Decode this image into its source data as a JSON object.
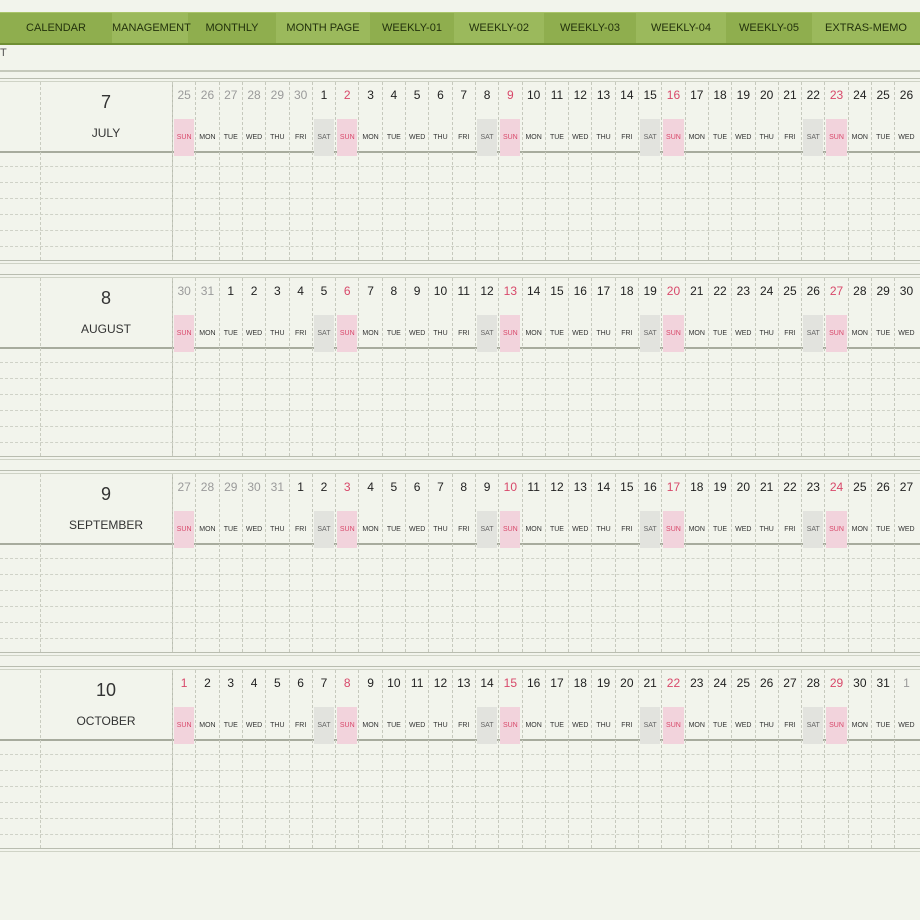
{
  "nav": {
    "tabs": [
      {
        "label": "CALENDAR"
      },
      {
        "label": "MANAGEMENT"
      },
      {
        "label": "MONTHLY"
      },
      {
        "label": "MONTH PAGE"
      },
      {
        "label": "WEEKLY-01"
      },
      {
        "label": "WEEKLY-02"
      },
      {
        "label": "WEEKLY-03"
      },
      {
        "label": "WEEKLY-04"
      },
      {
        "label": "WEEKLY-05"
      },
      {
        "label": "EXTRAS-MEMO"
      }
    ]
  },
  "subheader": {
    "fragment": "T"
  },
  "colors": {
    "nav": "#8fae4e",
    "sunday": "#d8486a",
    "sunday_bg": "#f2d3dc",
    "saturday_bg": "#e2e3de",
    "background": "#f2f4ec"
  },
  "months": [
    {
      "number": "7",
      "name": "JULY",
      "start_weekday": 0,
      "days": [
        {
          "n": "25",
          "other": true
        },
        {
          "n": "26",
          "other": true
        },
        {
          "n": "27",
          "other": true
        },
        {
          "n": "28",
          "other": true
        },
        {
          "n": "29",
          "other": true
        },
        {
          "n": "30",
          "other": true
        },
        {
          "n": "1"
        },
        {
          "n": "2"
        },
        {
          "n": "3"
        },
        {
          "n": "4"
        },
        {
          "n": "5"
        },
        {
          "n": "6"
        },
        {
          "n": "7"
        },
        {
          "n": "8"
        },
        {
          "n": "9"
        },
        {
          "n": "10"
        },
        {
          "n": "11"
        },
        {
          "n": "12"
        },
        {
          "n": "13"
        },
        {
          "n": "14"
        },
        {
          "n": "15"
        },
        {
          "n": "16"
        },
        {
          "n": "17"
        },
        {
          "n": "18"
        },
        {
          "n": "19"
        },
        {
          "n": "20"
        },
        {
          "n": "21"
        },
        {
          "n": "22"
        },
        {
          "n": "23"
        },
        {
          "n": "24"
        },
        {
          "n": "25"
        },
        {
          "n": "26"
        }
      ]
    },
    {
      "number": "8",
      "name": "AUGUST",
      "start_weekday": 0,
      "days": [
        {
          "n": "30",
          "other": true
        },
        {
          "n": "31",
          "other": true
        },
        {
          "n": "1"
        },
        {
          "n": "2"
        },
        {
          "n": "3"
        },
        {
          "n": "4"
        },
        {
          "n": "5"
        },
        {
          "n": "6"
        },
        {
          "n": "7"
        },
        {
          "n": "8"
        },
        {
          "n": "9"
        },
        {
          "n": "10"
        },
        {
          "n": "11"
        },
        {
          "n": "12"
        },
        {
          "n": "13"
        },
        {
          "n": "14"
        },
        {
          "n": "15"
        },
        {
          "n": "16"
        },
        {
          "n": "17"
        },
        {
          "n": "18"
        },
        {
          "n": "19"
        },
        {
          "n": "20"
        },
        {
          "n": "21"
        },
        {
          "n": "22"
        },
        {
          "n": "23"
        },
        {
          "n": "24"
        },
        {
          "n": "25"
        },
        {
          "n": "26"
        },
        {
          "n": "27"
        },
        {
          "n": "28"
        },
        {
          "n": "29"
        },
        {
          "n": "30"
        }
      ]
    },
    {
      "number": "9",
      "name": "SEPTEMBER",
      "start_weekday": 0,
      "days": [
        {
          "n": "27",
          "other": true
        },
        {
          "n": "28",
          "other": true
        },
        {
          "n": "29",
          "other": true
        },
        {
          "n": "30",
          "other": true
        },
        {
          "n": "31",
          "other": true
        },
        {
          "n": "1"
        },
        {
          "n": "2"
        },
        {
          "n": "3"
        },
        {
          "n": "4"
        },
        {
          "n": "5"
        },
        {
          "n": "6"
        },
        {
          "n": "7"
        },
        {
          "n": "8"
        },
        {
          "n": "9"
        },
        {
          "n": "10"
        },
        {
          "n": "11"
        },
        {
          "n": "12"
        },
        {
          "n": "13"
        },
        {
          "n": "14"
        },
        {
          "n": "15"
        },
        {
          "n": "16"
        },
        {
          "n": "17"
        },
        {
          "n": "18"
        },
        {
          "n": "19"
        },
        {
          "n": "20"
        },
        {
          "n": "21"
        },
        {
          "n": "22"
        },
        {
          "n": "23"
        },
        {
          "n": "24"
        },
        {
          "n": "25"
        },
        {
          "n": "26"
        },
        {
          "n": "27"
        }
      ]
    },
    {
      "number": "10",
      "name": "OCTOBER",
      "start_weekday": 0,
      "days": [
        {
          "n": "1"
        },
        {
          "n": "2"
        },
        {
          "n": "3"
        },
        {
          "n": "4"
        },
        {
          "n": "5"
        },
        {
          "n": "6"
        },
        {
          "n": "7"
        },
        {
          "n": "8"
        },
        {
          "n": "9"
        },
        {
          "n": "10"
        },
        {
          "n": "11"
        },
        {
          "n": "12"
        },
        {
          "n": "13"
        },
        {
          "n": "14"
        },
        {
          "n": "15"
        },
        {
          "n": "16"
        },
        {
          "n": "17"
        },
        {
          "n": "18"
        },
        {
          "n": "19"
        },
        {
          "n": "20"
        },
        {
          "n": "21"
        },
        {
          "n": "22"
        },
        {
          "n": "23"
        },
        {
          "n": "24"
        },
        {
          "n": "25"
        },
        {
          "n": "26"
        },
        {
          "n": "27"
        },
        {
          "n": "28"
        },
        {
          "n": "29"
        },
        {
          "n": "30"
        },
        {
          "n": "31"
        },
        {
          "n": "1",
          "other": true
        }
      ]
    }
  ],
  "weekdays": [
    "SUN",
    "MON",
    "TUE",
    "WED",
    "THU",
    "FRI",
    "SAT"
  ]
}
